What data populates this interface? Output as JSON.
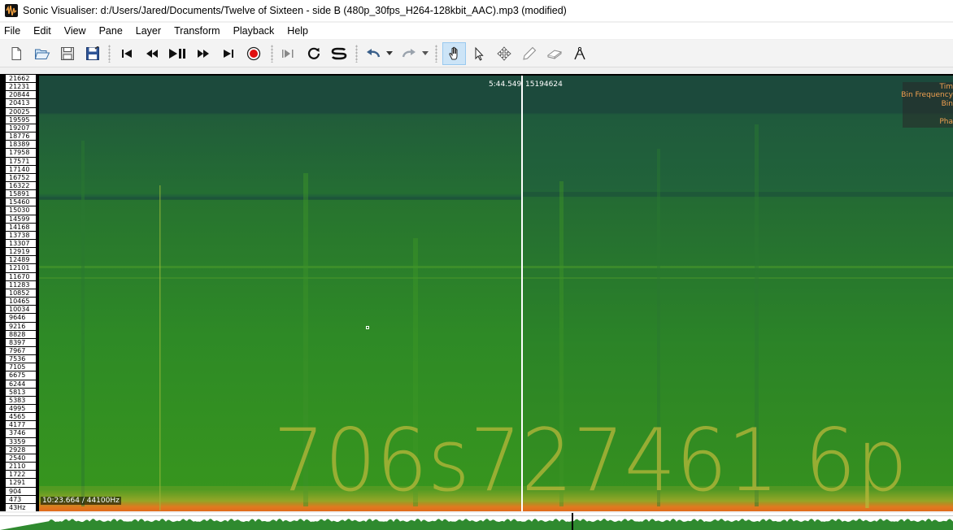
{
  "window": {
    "title": "Sonic Visualiser: d:/Users/Jared/Documents/Twelve of Sixteen - side B (480p_30fps_H264-128kbit_AAC).mp3 (modified)"
  },
  "menu": [
    "File",
    "Edit",
    "View",
    "Pane",
    "Layer",
    "Transform",
    "Playback",
    "Help"
  ],
  "toolbar": {
    "file_tools": [
      "new-session-icon",
      "open-file-icon",
      "save-icon",
      "save-as-icon"
    ],
    "transport": [
      "rewind-start-icon",
      "rewind-icon",
      "play-pause-icon",
      "fast-forward-icon",
      "fast-forward-end-icon",
      "record-icon"
    ],
    "play_modes": [
      "constrain-playback-icon",
      "loop-icon",
      "solo-icon"
    ],
    "history": [
      "undo-icon",
      "undo-dropdown-icon",
      "redo-icon",
      "redo-dropdown-icon"
    ],
    "tools": [
      "navigate-tool-icon",
      "select-tool-icon",
      "move-tool-icon",
      "draw-tool-icon",
      "erase-tool-icon",
      "measure-tool-icon"
    ],
    "active_tool": "navigate-tool-icon"
  },
  "pane": {
    "frequency_labels": [
      "21662",
      "21231",
      "20844",
      "20413",
      "20025",
      "19595",
      "19207",
      "18776",
      "18389",
      "17958",
      "17571",
      "17140",
      "16752",
      "16322",
      "15891",
      "15460",
      "15030",
      "14599",
      "14168",
      "13738",
      "13307",
      "12919",
      "12489",
      "12101",
      "11670",
      "11283",
      "10852",
      "10465",
      "10034",
      "9646",
      "9216",
      "8828",
      "8397",
      "7967",
      "7536",
      "7105",
      "6675",
      "6244",
      "5813",
      "5383",
      "4995",
      "4565",
      "4177",
      "3746",
      "3359",
      "2928",
      "2540",
      "2110",
      "1722",
      "1291",
      "904",
      "473",
      "43Hz"
    ],
    "playhead_time": "5:44.549",
    "playhead_frame": "15194624",
    "duration_rate": "10:23.664 / 44100Hz",
    "hidden_text": "706s727461 6p",
    "info_rows": [
      "Tim",
      "Bin Frequency",
      "Bin",
      "",
      "Pha"
    ]
  },
  "colors": {
    "spectrogram_high": "#1c4a3c",
    "spectrogram_mid": "#2d8a25",
    "spectrogram_text": "#b9b83a",
    "spectrogram_bottom": "#e07a20",
    "info_text": "#f0a050"
  }
}
